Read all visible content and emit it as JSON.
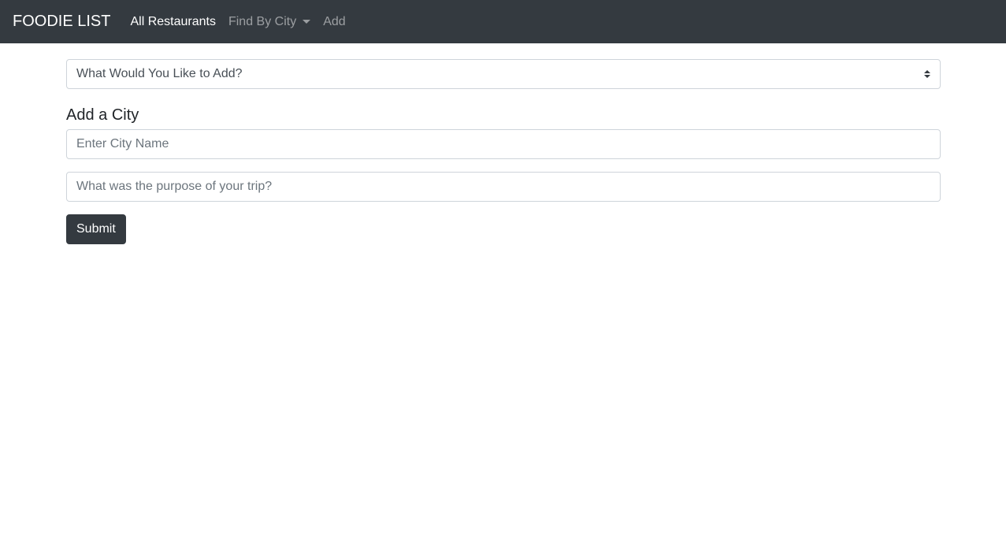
{
  "navbar": {
    "brand": "FOODIE LIST",
    "links": {
      "all_restaurants": "All Restaurants",
      "find_by_city": "Find By City",
      "add": "Add"
    }
  },
  "form": {
    "select_value": "What Would You Like to Add?",
    "heading": "Add a City",
    "city_placeholder": "Enter City Name",
    "purpose_placeholder": "What was the purpose of your trip?",
    "submit_label": "Submit"
  },
  "colors": {
    "navbar_bg": "#343a40",
    "button_bg": "#343a40"
  }
}
